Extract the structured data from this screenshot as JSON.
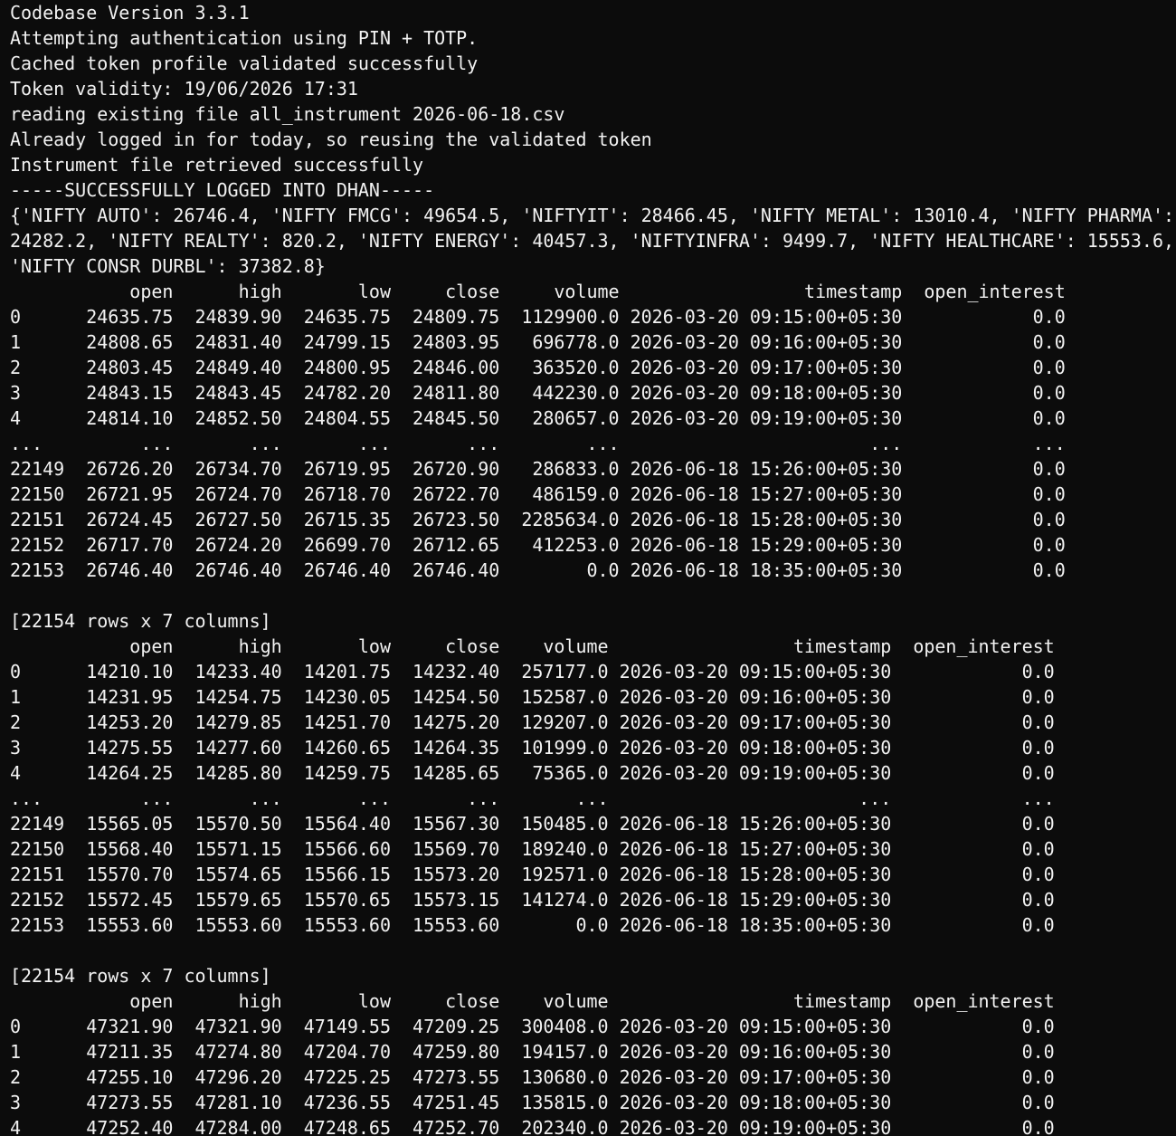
{
  "terminal": {
    "lines": [
      "Codebase Version 3.3.1",
      "Attempting authentication using PIN + TOTP.",
      "Cached token profile validated successfully",
      "Token validity: 19/06/2026 17:31",
      "reading existing file all_instrument 2026-06-18.csv",
      "Already logged in for today, so reusing the validated token",
      "Instrument file retrieved successfully",
      "-----SUCCESSFULLY LOGGED INTO DHAN-----",
      "{'NIFTY AUTO': 26746.4, 'NIFTY FMCG': 49654.5, 'NIFTYIT': 28466.45, 'NIFTY METAL': 13010.4, 'NIFTY PHARMA':",
      "24282.2, 'NIFTY REALTY': 820.2, 'NIFTY ENERGY': 40457.3, 'NIFTYINFRA': 9499.7, 'NIFTY HEALTHCARE': 15553.6,",
      "'NIFTY CONSR DURBL': 37382.8}",
      "           open      high       low     close     volume                 timestamp  open_interest",
      "0      24635.75  24839.90  24635.75  24809.75  1129900.0 2026-03-20 09:15:00+05:30            0.0",
      "1      24808.65  24831.40  24799.15  24803.95   696778.0 2026-03-20 09:16:00+05:30            0.0",
      "2      24803.45  24849.40  24800.95  24846.00   363520.0 2026-03-20 09:17:00+05:30            0.0",
      "3      24843.15  24843.45  24782.20  24811.80   442230.0 2026-03-20 09:18:00+05:30            0.0",
      "4      24814.10  24852.50  24804.55  24845.50   280657.0 2026-03-20 09:19:00+05:30            0.0",
      "...         ...       ...       ...       ...        ...                       ...            ...",
      "22149  26726.20  26734.70  26719.95  26720.90   286833.0 2026-06-18 15:26:00+05:30            0.0",
      "22150  26721.95  26724.70  26718.70  26722.70   486159.0 2026-06-18 15:27:00+05:30            0.0",
      "22151  26724.45  26727.50  26715.35  26723.50  2285634.0 2026-06-18 15:28:00+05:30            0.0",
      "22152  26717.70  26724.20  26699.70  26712.65   412253.0 2026-06-18 15:29:00+05:30            0.0",
      "22153  26746.40  26746.40  26746.40  26746.40        0.0 2026-06-18 18:35:00+05:30            0.0",
      "",
      "[22154 rows x 7 columns]",
      "           open      high       low     close    volume                 timestamp  open_interest",
      "0      14210.10  14233.40  14201.75  14232.40  257177.0 2026-03-20 09:15:00+05:30            0.0",
      "1      14231.95  14254.75  14230.05  14254.50  152587.0 2026-03-20 09:16:00+05:30            0.0",
      "2      14253.20  14279.85  14251.70  14275.20  129207.0 2026-03-20 09:17:00+05:30            0.0",
      "3      14275.55  14277.60  14260.65  14264.35  101999.0 2026-03-20 09:18:00+05:30            0.0",
      "4      14264.25  14285.80  14259.75  14285.65   75365.0 2026-03-20 09:19:00+05:30            0.0",
      "...         ...       ...       ...       ...       ...                       ...            ...",
      "22149  15565.05  15570.50  15564.40  15567.30  150485.0 2026-06-18 15:26:00+05:30            0.0",
      "22150  15568.40  15571.15  15566.60  15569.70  189240.0 2026-06-18 15:27:00+05:30            0.0",
      "22151  15570.70  15574.65  15566.15  15573.20  192571.0 2026-06-18 15:28:00+05:30            0.0",
      "22152  15572.45  15579.65  15570.65  15573.15  141274.0 2026-06-18 15:29:00+05:30            0.0",
      "22153  15553.60  15553.60  15553.60  15553.60       0.0 2026-06-18 18:35:00+05:30            0.0",
      "",
      "[22154 rows x 7 columns]",
      "           open      high       low     close    volume                 timestamp  open_interest",
      "0      47321.90  47321.90  47149.55  47209.25  300408.0 2026-03-20 09:15:00+05:30            0.0",
      "1      47211.35  47274.80  47204.70  47259.80  194157.0 2026-03-20 09:16:00+05:30            0.0",
      "2      47255.10  47296.20  47225.25  47273.55  130680.0 2026-03-20 09:17:00+05:30            0.0",
      "3      47273.55  47281.10  47236.55  47251.45  135815.0 2026-03-20 09:18:00+05:30            0.0",
      "4      47252.40  47284.00  47248.65  47252.70  202340.0 2026-03-20 09:19:00+05:30            0.0"
    ]
  }
}
